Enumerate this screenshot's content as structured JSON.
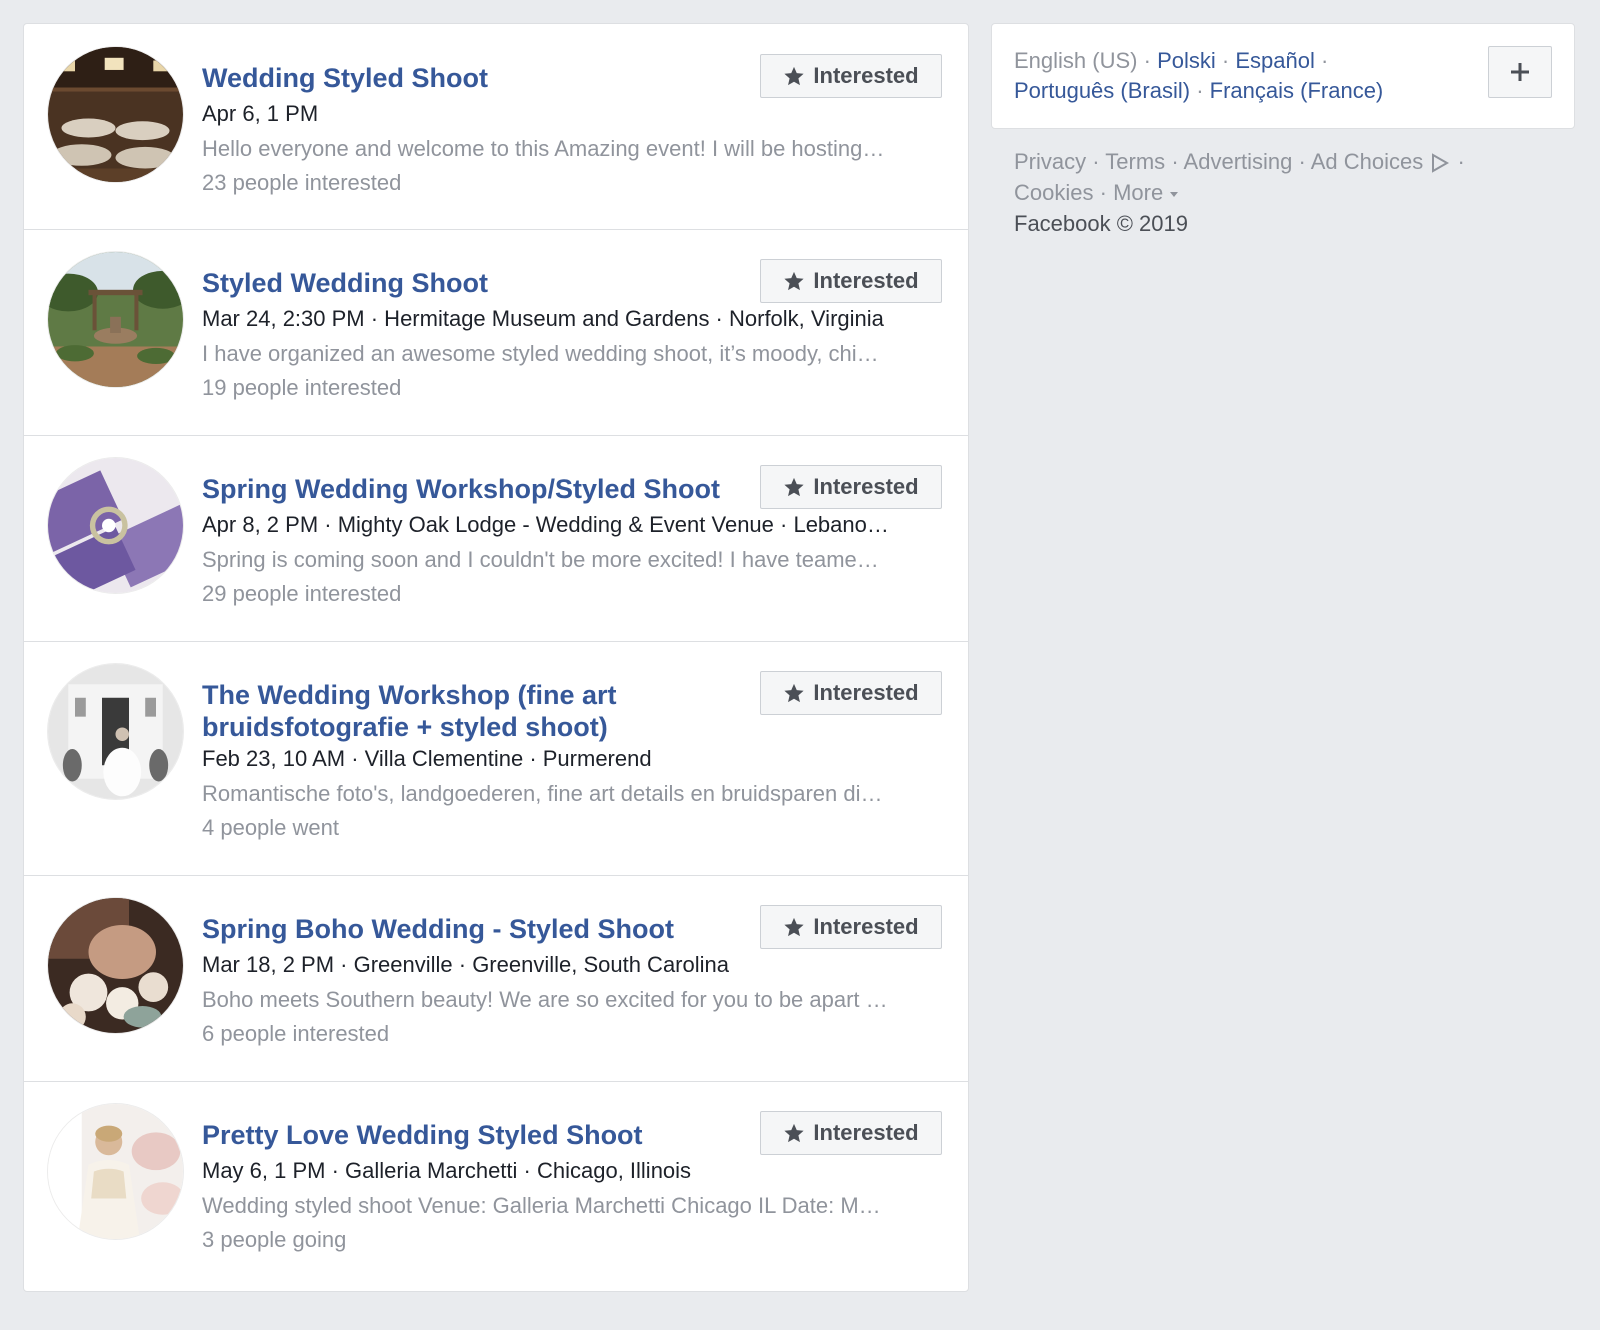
{
  "events": [
    {
      "title": "Wedding Styled Shoot",
      "meta": "Apr 6, 1 PM",
      "description": "Hello everyone and welcome to this Amazing event! I will be hosting…",
      "count": "23 people interested",
      "button_label": "Interested"
    },
    {
      "title": "Styled Wedding Shoot",
      "meta": "Mar 24, 2:30 PM · Hermitage Museum and Gardens · Norfolk, Virginia",
      "description": "I have organized an awesome styled wedding shoot, it’s moody, chi…",
      "count": "19 people interested",
      "button_label": "Interested"
    },
    {
      "title": "Spring Wedding Workshop/Styled Shoot",
      "meta": "Apr 8, 2 PM · Mighty Oak Lodge - Wedding & Event Venue · Lebano…",
      "description": "Spring is coming soon and I couldn't be more excited! I have teame…",
      "count": "29 people interested",
      "button_label": "Interested"
    },
    {
      "title": "The Wedding Workshop (fine art bruidsfotografie + styled shoot)",
      "meta": "Feb 23, 10 AM · Villa Clementine · Purmerend",
      "description": "Romantische foto's, landgoederen, fine art details en bruidsparen di…",
      "count": "4 people went",
      "button_label": "Interested"
    },
    {
      "title": "Spring Boho Wedding - Styled Shoot",
      "meta": "Mar 18, 2 PM · Greenville · Greenville, South Carolina",
      "description": "Boho meets Southern beauty! We are so excited for you to be apart …",
      "count": "6 people interested",
      "button_label": "Interested"
    },
    {
      "title": "Pretty Love Wedding Styled Shoot",
      "meta": "May 6, 1 PM · Galleria Marchetti · Chicago, Illinois",
      "description": "Wedding styled shoot Venue: Galleria Marchetti Chicago IL Date: M…",
      "count": "3 people going",
      "button_label": "Interested"
    }
  ],
  "languages": {
    "current": "English (US)",
    "links": [
      "Polski",
      "Español",
      "Português (Brasil)",
      "Français (France)"
    ],
    "separator": "·",
    "add_icon": "plus-icon"
  },
  "footer": {
    "privacy": "Privacy",
    "terms": "Terms",
    "advertising": "Advertising",
    "ad_choices": "Ad Choices",
    "cookies": "Cookies",
    "more": "More",
    "copyright": "Facebook © 2019"
  },
  "colors": {
    "link_blue": "#365899",
    "muted_gray": "#90949c",
    "page_bg": "#e9ebee"
  },
  "icons": {
    "button": "star-icon",
    "ad_choices": "ad-choices-icon",
    "more": "caret-down-icon"
  }
}
